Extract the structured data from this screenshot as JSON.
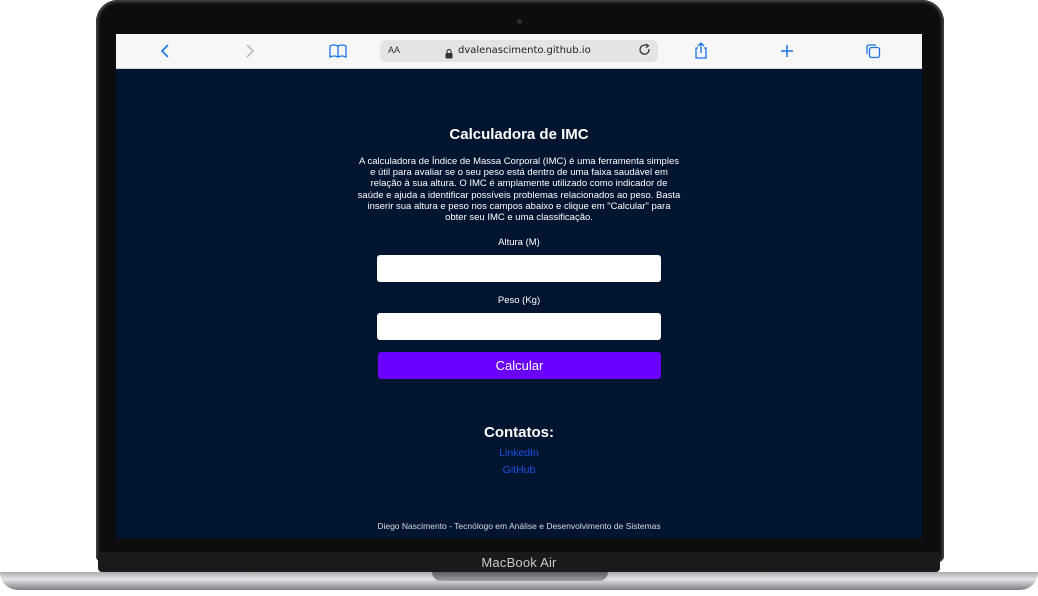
{
  "device": {
    "brand_label": "MacBook Air"
  },
  "browser": {
    "reader_label": "AA",
    "url": "dvalenascimento.github.io",
    "icons": [
      "back-icon",
      "forward-icon",
      "bookmarks-icon",
      "lock-icon",
      "reload-icon",
      "share-icon",
      "new-tab-icon",
      "tabs-icon"
    ]
  },
  "page": {
    "title": "Calculadora de IMC",
    "description": "A calculadora de Índice de Massa Corporal (IMC) é uma ferramenta simples e útil para avaliar se o seu peso está dentro de uma faixa saudável em relação à sua altura. O IMC é amplamente utilizado como indicador de saúde e ajuda a identificar possíveis problemas relacionados ao peso. Basta inserir sua altura e peso nos campos abaixo e clique em \"Calcular\" para obter seu IMC e uma classificação.",
    "height_label": "Altura (M)",
    "height_value": "",
    "weight_label": "Peso (Kg)",
    "weight_value": "",
    "calculate_label": "Calcular",
    "contacts_title": "Contatos:",
    "links": [
      {
        "label": "LinkedIn"
      },
      {
        "label": "GitHub"
      }
    ],
    "footer": "Diego Nascimento - Tecnólogo em Análise e Desenvolvimento de Sistemas"
  },
  "colors": {
    "background": "#011430",
    "accent_button": "#6a00ff",
    "link": "#1a53e6"
  }
}
